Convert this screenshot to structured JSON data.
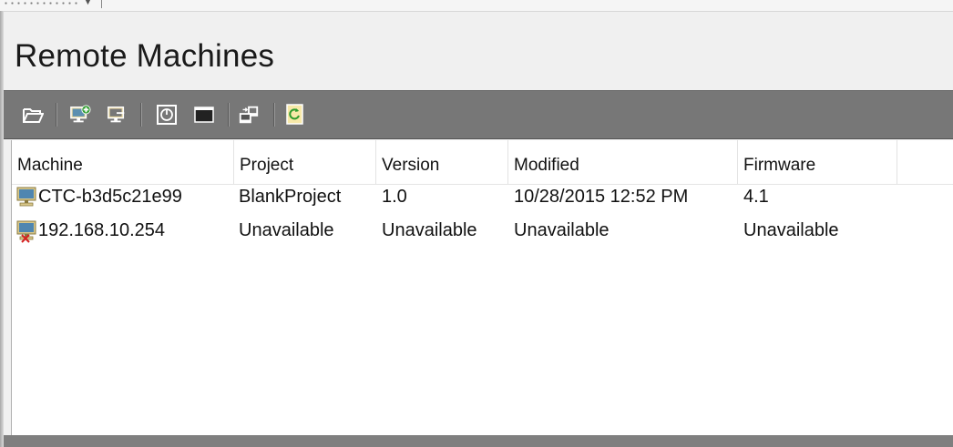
{
  "panel": {
    "title": "Remote Machines"
  },
  "toolbar": {
    "buttons": [
      {
        "name": "open-folder",
        "icon": "open-folder-icon"
      },
      {
        "name": "add-machine",
        "icon": "add-machine-icon"
      },
      {
        "name": "remove-machine",
        "icon": "remove-machine-icon"
      },
      {
        "name": "power",
        "icon": "power-icon"
      },
      {
        "name": "window",
        "icon": "window-icon"
      },
      {
        "name": "transfer",
        "icon": "transfer-icon"
      },
      {
        "name": "refresh",
        "icon": "refresh-icon"
      }
    ]
  },
  "table": {
    "columns": [
      "Machine",
      "Project",
      "Version",
      "Modified",
      "Firmware"
    ],
    "rows": [
      {
        "machine": "CTC-b3d5c21e99",
        "project": "BlankProject",
        "version": "1.0",
        "modified": "10/28/2015 12:52 PM",
        "firmware": "4.1",
        "status_icon": "machine-online-icon"
      },
      {
        "machine": "192.168.10.254",
        "project": "Unavailable",
        "version": "Unavailable",
        "modified": "Unavailable",
        "firmware": "Unavailable",
        "status_icon": "machine-offline-icon"
      }
    ]
  },
  "colors": {
    "toolbar_bg": "#777777",
    "list_bg": "#ffffff",
    "panel_bg": "#f0f0f0"
  }
}
